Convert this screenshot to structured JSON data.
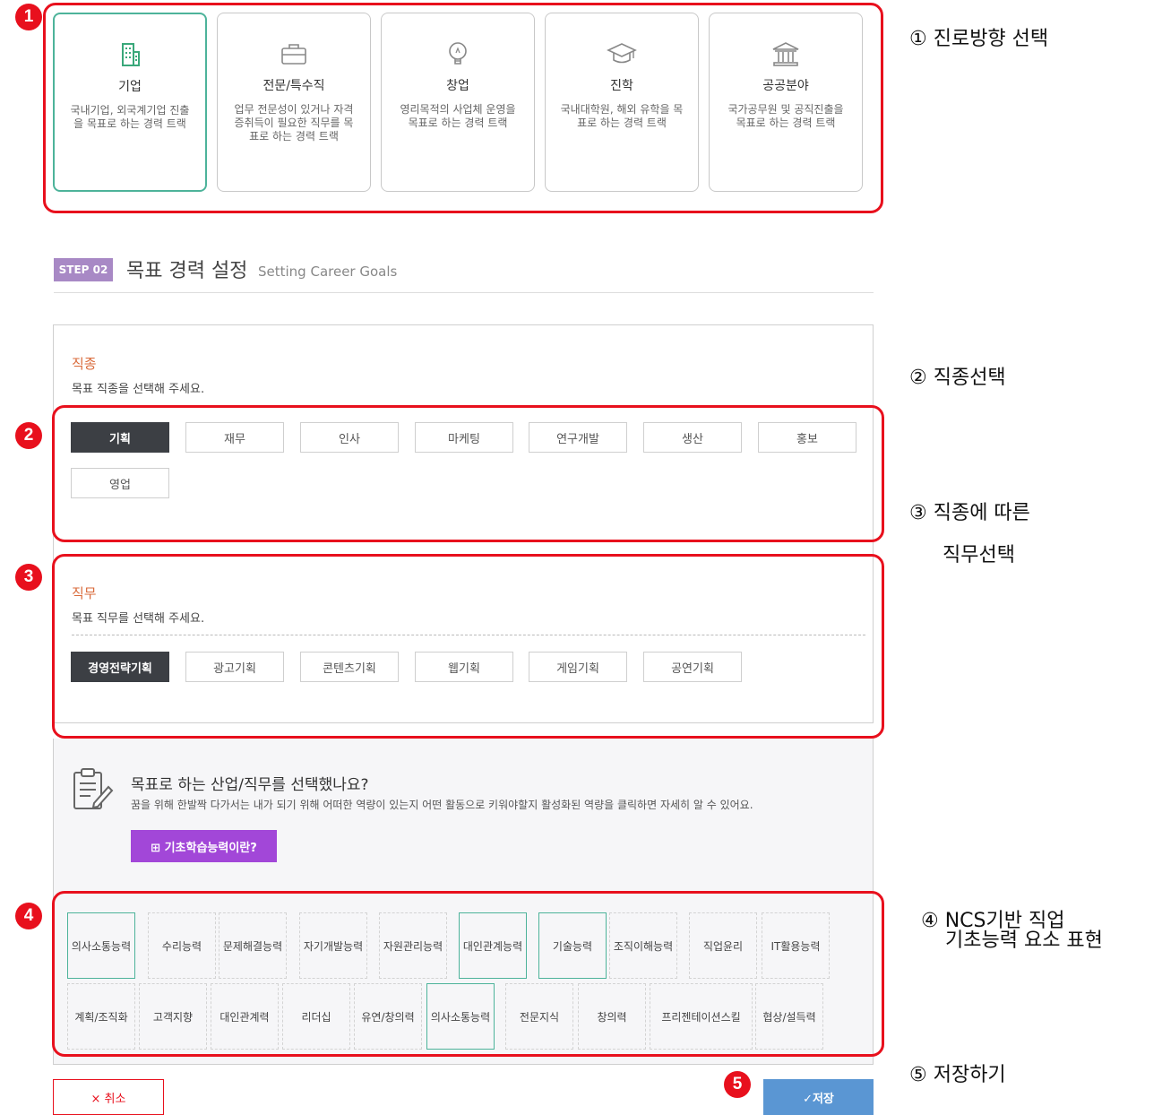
{
  "annotations": {
    "a1": "① 진로방향 선택",
    "a2": "② 직종선택",
    "a3_line1": "③ 직종에 따른",
    "a3_line2": "직무선택",
    "a4_line1": "④ NCS기반 직업",
    "a4_line2": "기초능력 요소 표현",
    "a5": "⑤ 저장하기"
  },
  "badges": [
    "1",
    "2",
    "3",
    "4",
    "5"
  ],
  "careers": [
    {
      "title": "기업",
      "desc": "국내기업, 외국계기업 진출을 목표로 하는 경력 트랙",
      "icon": "building-icon",
      "selected": true
    },
    {
      "title": "전문/특수직",
      "desc": "업무 전문성이 있거나 자격증취득이 필요한 직무를 목표로 하는 경력 트랙",
      "icon": "briefcase-icon",
      "selected": false
    },
    {
      "title": "창업",
      "desc": "영리목적의 사업체 운영을 목표로 하는 경력 트랙",
      "icon": "lightbulb-icon",
      "selected": false
    },
    {
      "title": "진학",
      "desc": "국내대학원, 해외 유학을 목표로 하는 경력 트랙",
      "icon": "graduation-cap-icon",
      "selected": false
    },
    {
      "title": "공공분야",
      "desc": "국가공무원 및 공직진출을 목표로 하는 경력 트랙",
      "icon": "government-building-icon",
      "selected": false
    }
  ],
  "step": {
    "badge": "STEP 02",
    "title": "목표 경력 설정",
    "subtitle": "Setting Career Goals"
  },
  "occupation": {
    "title": "직종",
    "desc": "목표 직종을 선택해 주세요.",
    "options": [
      "기획",
      "재무",
      "인사",
      "마케팅",
      "연구개발",
      "생산",
      "홍보",
      "영업"
    ],
    "selected": "기획"
  },
  "job": {
    "title": "직무",
    "desc": "목표 직무를 선택해 주세요.",
    "options": [
      "경영전략기획",
      "광고기획",
      "콘텐츠기획",
      "웹기획",
      "게임기획",
      "공연기획"
    ],
    "selected": "경영전략기획"
  },
  "info": {
    "title": "목표로 하는 산업/직무를 선택했나요?",
    "desc": "꿈을 위해 한발짝 다가서는 내가 되기 위해 어떠한 역량이 있는지 어떤 활동으로 키워야할지 활성화된 역량을 클릭하면 자세히 알 수 있어요.",
    "button": "⊞ 기초학습능력이란?",
    "icon": "clipboard-edit-icon"
  },
  "abilities_row1": [
    "의사소통능력",
    "수리능력",
    "문제해결능력",
    "자기개발능력",
    "자원관리능력",
    "대인관계능력",
    "기술능력",
    "조직이해능력",
    "직업윤리",
    "IT활용능력"
  ],
  "abilities_row2": [
    "계획/조직화",
    "고객지향",
    "대인관계력",
    "리더십",
    "유연/창의력",
    "의사소통능력",
    "전문지식",
    "창의력",
    "프리젠테이션스킬",
    "협상/설득력"
  ],
  "active_row1": [
    "의사소통능력",
    "대인관계능력",
    "기술능력"
  ],
  "active_row2": [
    "의사소통능력"
  ],
  "footer": {
    "cancel": "× 취소",
    "save": "✓저장"
  },
  "colors": {
    "highlight_red": "#e8101d",
    "selected_green": "#4db39a",
    "step_purple": "#a889c5",
    "button_purple": "#a247d8",
    "save_blue": "#5a96d3",
    "section_orange": "#d96a3a"
  }
}
